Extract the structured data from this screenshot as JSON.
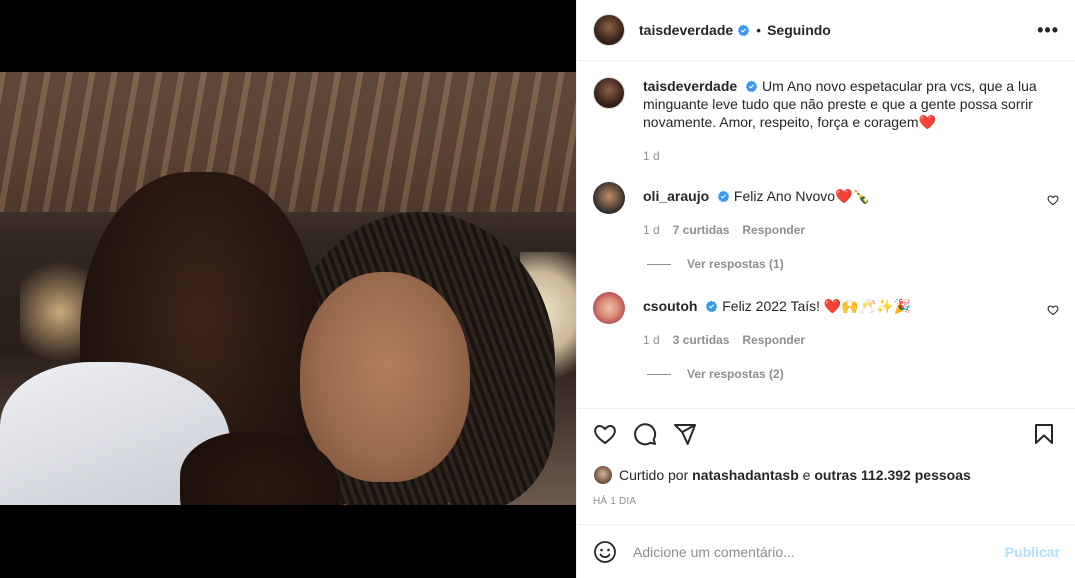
{
  "post": {
    "author": "taisdeverdade",
    "follow_state": "Seguindo",
    "separator": "•",
    "more_label": "•••"
  },
  "caption": {
    "username": "taisdeverdade",
    "text": "Um Ano novo espetacular pra vcs, que a lua minguante leve tudo que não preste e que a gente possa sorrir novamente. Amor, respeito, força e coragem",
    "emoji": "❤️",
    "time": "1 d"
  },
  "comments": [
    {
      "username": "oli_araujo",
      "text": "Feliz Ano Nvovo",
      "emoji": "❤️🍾",
      "time": "1 d",
      "likes": "7 curtidas",
      "reply_label": "Responder",
      "view_replies": "Ver respostas (1)"
    },
    {
      "username": "csoutoh",
      "text": "Feliz 2022 Taís!",
      "emoji": "❤️🙌🥂✨🎉",
      "time": "1 d",
      "likes": "3 curtidas",
      "reply_label": "Responder",
      "view_replies": "Ver respostas (2)"
    }
  ],
  "likes_summary": {
    "prefix": "Curtido por",
    "user": "natashadantasb",
    "middle": "e",
    "others": "outras 112.392 pessoas"
  },
  "posted_time": "HÁ 1 DIA",
  "comment_box": {
    "placeholder": "Adicione um comentário...",
    "publish_label": "Publicar"
  },
  "colors": {
    "verified": "#3897f0",
    "heart": "#ed2939",
    "publish_disabled": "#b2dffc",
    "secondary_text": "#8e8e8e"
  }
}
